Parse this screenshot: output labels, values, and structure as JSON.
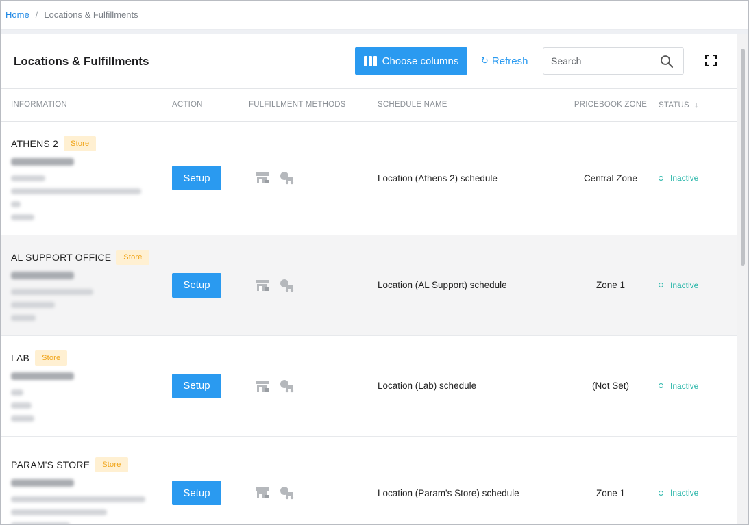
{
  "breadcrumb": {
    "home": "Home",
    "separator": "/",
    "current": "Locations & Fulfillments"
  },
  "header": {
    "title": "Locations & Fulfillments",
    "choose_columns": "Choose columns",
    "refresh": "Refresh",
    "search_placeholder": "Search"
  },
  "table": {
    "columns": [
      "INFORMATION",
      "ACTION",
      "FULFILLMENT METHODS",
      "SCHEDULE NAME",
      "PRICEBOOK ZONE",
      "STATUS"
    ],
    "sort_indicator": "↓",
    "rows": [
      {
        "name": "ATHENS 2",
        "badge": "Store",
        "action": "Setup",
        "schedule": "Location (Athens 2) schedule",
        "zone": "Central Zone",
        "status": "Inactive"
      },
      {
        "name": "AL SUPPORT OFFICE",
        "badge": "Store",
        "action": "Setup",
        "schedule": "Location (AL Support) schedule",
        "zone": "Zone 1",
        "status": "Inactive"
      },
      {
        "name": "LAB",
        "badge": "Store",
        "action": "Setup",
        "schedule": "Location (Lab) schedule",
        "zone": "(Not Set)",
        "status": "Inactive"
      },
      {
        "name": "PARAM'S STORE",
        "badge": "Store",
        "action": "Setup",
        "schedule": "Location (Param's Store) schedule",
        "zone": "Zone 1",
        "status": "Inactive"
      }
    ]
  },
  "colors": {
    "accent": "#2a9af0",
    "status_inactive": "#26b5a8",
    "badge_bg": "#fff0d2",
    "badge_text": "#f0a418"
  },
  "icons": [
    "columns-icon",
    "refresh-icon",
    "search-icon",
    "fullscreen-icon",
    "store-pickup-icon",
    "delivery-truck-icon",
    "status-dot-icon"
  ]
}
